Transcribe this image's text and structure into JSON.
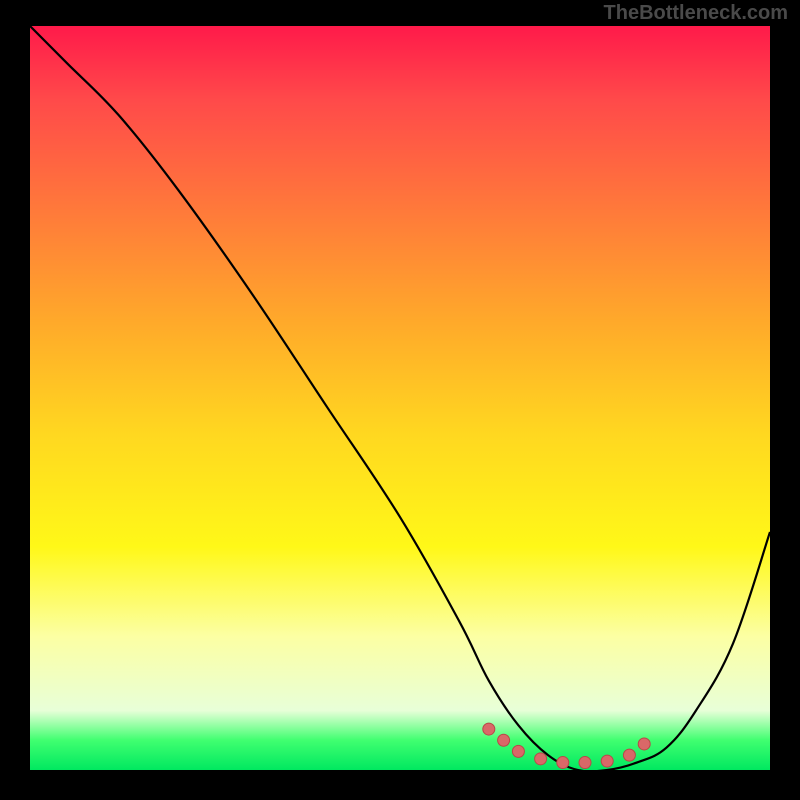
{
  "watermark": "TheBottleneck.com",
  "chart_data": {
    "type": "line",
    "title": "",
    "xlabel": "",
    "ylabel": "",
    "xlim": [
      0,
      100
    ],
    "ylim": [
      0,
      100
    ],
    "series": [
      {
        "name": "bottleneck-curve",
        "x": [
          0,
          5,
          12,
          20,
          30,
          40,
          50,
          58,
          62,
          66,
          70,
          74,
          78,
          82,
          86,
          90,
          95,
          100
        ],
        "y": [
          100,
          95,
          88,
          78,
          64,
          49,
          34,
          20,
          12,
          6,
          2,
          0,
          0,
          1,
          3,
          8,
          17,
          32
        ]
      }
    ],
    "markers": {
      "name": "optimal-range",
      "x": [
        62,
        64,
        66,
        69,
        72,
        75,
        78,
        81,
        83
      ],
      "y": [
        5.5,
        4,
        2.5,
        1.5,
        1,
        1,
        1.2,
        2,
        3.5
      ]
    },
    "gradient_stops": [
      {
        "pos": 0,
        "color": "#ff1a4a"
      },
      {
        "pos": 25,
        "color": "#ff7a3a"
      },
      {
        "pos": 55,
        "color": "#ffd820"
      },
      {
        "pos": 82,
        "color": "#fcffa3"
      },
      {
        "pos": 100,
        "color": "#00e860"
      }
    ]
  }
}
